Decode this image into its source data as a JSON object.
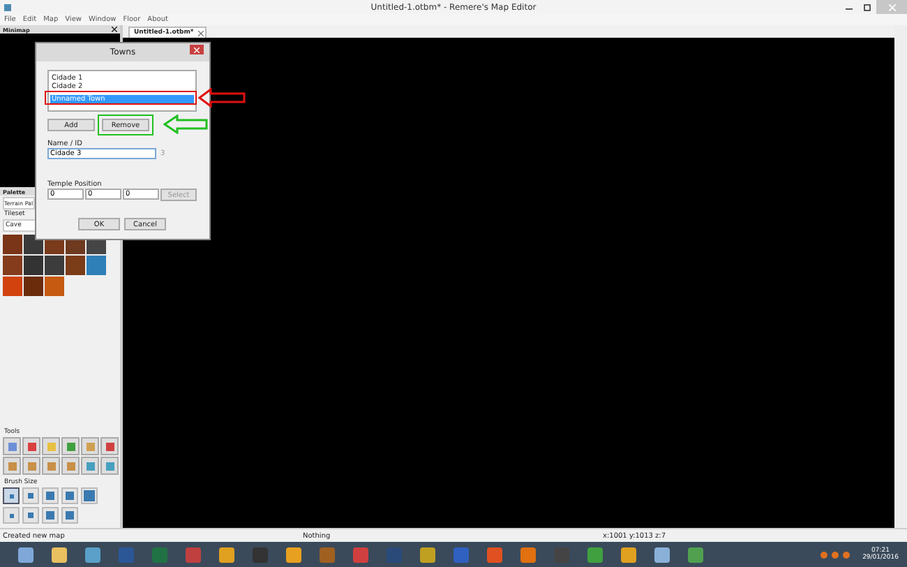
{
  "window": {
    "title": "Untitled-1.otbm* - Remere's Map Editor"
  },
  "menu": [
    "File",
    "Edit",
    "Map",
    "View",
    "Window",
    "Floor",
    "About"
  ],
  "minimap": {
    "title": "Minimap"
  },
  "tabs": [
    {
      "label": "Untitled-1.otbm*",
      "selected": true
    }
  ],
  "palette": {
    "title": "Palette",
    "tab": "Terrain Pal",
    "tileset_label": "Tileset",
    "tileset": "Cave",
    "tiles": [
      {
        "color": "#7a3417"
      },
      {
        "color": "#3a3a3a"
      },
      {
        "color": "#7a3a1c"
      },
      {
        "color": "#6e3a20"
      },
      {
        "color": "#454545"
      },
      {
        "color": "#853c1c"
      },
      {
        "color": "#333333"
      },
      {
        "color": "#3c3c3c"
      },
      {
        "color": "#7b3c18"
      },
      {
        "color": "#2f7fb8"
      },
      {
        "color": "#d2420e"
      },
      {
        "color": "#6b2c0c"
      },
      {
        "color": "#c55a10"
      }
    ],
    "tools_label": "Tools",
    "tools": [
      {
        "color": "#6d8fd8"
      },
      {
        "color": "#d84040"
      },
      {
        "color": "#e8c040"
      },
      {
        "color": "#40a040"
      },
      {
        "color": "#d0a050"
      },
      {
        "color": "#d04040"
      },
      {
        "color": "#c89048"
      },
      {
        "color": "#c89048"
      },
      {
        "color": "#c89048"
      },
      {
        "color": "#c89048"
      },
      {
        "color": "#48a0c0"
      },
      {
        "color": "#48a0c0"
      }
    ],
    "brush_label": "Brush Size",
    "brushes": [
      {
        "selected": true
      },
      {
        "selected": false
      },
      {
        "selected": false
      },
      {
        "selected": false
      },
      {
        "selected": false
      },
      {
        "selected": false
      },
      {
        "selected": false
      },
      {
        "selected": false
      },
      {
        "selected": false
      }
    ]
  },
  "dialog": {
    "title": "Towns",
    "towns": [
      {
        "name": "Cidade 1",
        "selected": false
      },
      {
        "name": "Cidade 2",
        "selected": false
      },
      {
        "name": "Unnamed Town",
        "selected": true
      }
    ],
    "add": "Add",
    "remove": "Remove",
    "name_label": "Name / ID",
    "name": "Cidade 3",
    "id": "3",
    "temple_label": "Temple Position",
    "temple": [
      "0",
      "0",
      "0"
    ],
    "select": "Select",
    "select_disabled": true,
    "ok": "OK",
    "cancel": "Cancel"
  },
  "status_bar": [
    "Created new map",
    "Nothing",
    "x:1001 y:1013 z:7"
  ],
  "taskbar": {
    "apps": [
      {
        "color": "#7fa8d8"
      },
      {
        "color": "#e8c060"
      },
      {
        "color": "#5aa0c8"
      },
      {
        "color": "#2b5797"
      },
      {
        "color": "#207245"
      },
      {
        "color": "#c04040"
      },
      {
        "color": "#e0a020"
      },
      {
        "color": "#333333"
      },
      {
        "color": "#e8a020"
      },
      {
        "color": "#a06020"
      },
      {
        "color": "#d04040"
      },
      {
        "color": "#2a4a7a"
      },
      {
        "color": "#c0a020"
      },
      {
        "color": "#3060c0"
      },
      {
        "color": "#e05020"
      },
      {
        "color": "#e07010"
      },
      {
        "color": "#444444"
      },
      {
        "color": "#40a040"
      },
      {
        "color": "#e0a020"
      },
      {
        "color": "#8ab0d8"
      },
      {
        "color": "#50a050"
      }
    ],
    "time": "07:21",
    "date": "29/01/2016"
  }
}
